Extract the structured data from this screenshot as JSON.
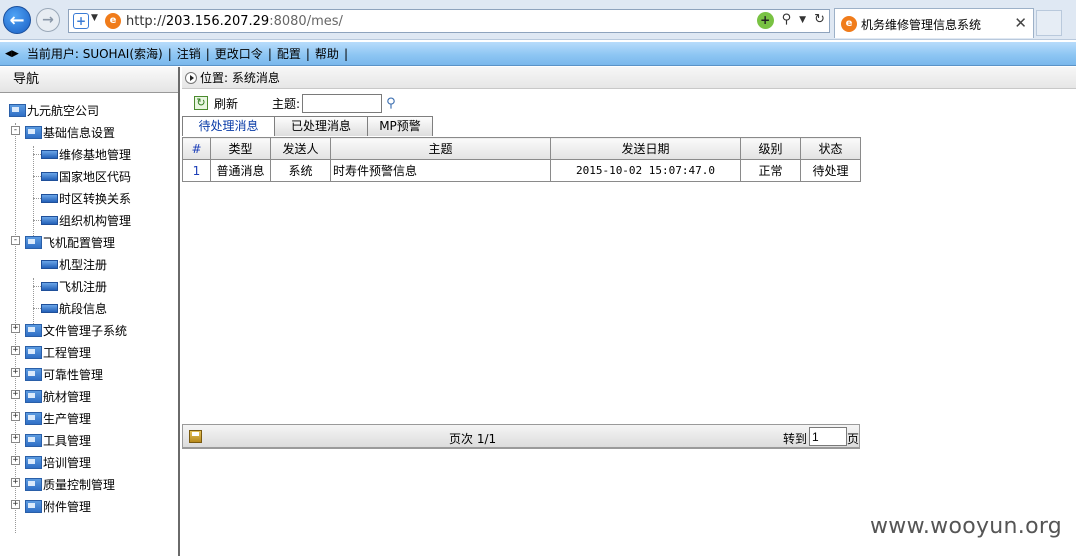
{
  "browser": {
    "url_prefix": "http://",
    "url_host": "203.156.207.29",
    "url_port": ":8080",
    "url_path": "/mes/",
    "tab_title": "机务维修管理信息系统"
  },
  "topbar": {
    "current_user": "当前用户: SUOHAI(索海)",
    "links": [
      "注销",
      "更改口令",
      "配置",
      "帮助"
    ]
  },
  "nav": {
    "header": "导航",
    "root": "九元航空公司",
    "groups": [
      {
        "label": "基础信息设置",
        "expanded": true,
        "children": [
          "维修基地管理",
          "国家地区代码",
          "时区转换关系",
          "组织机构管理"
        ]
      },
      {
        "label": "飞机配置管理",
        "expanded": true,
        "children": [
          "机型注册",
          "飞机注册",
          "航段信息"
        ]
      },
      {
        "label": "文件管理子系统",
        "expanded": false
      },
      {
        "label": "工程管理",
        "expanded": false
      },
      {
        "label": "可靠性管理",
        "expanded": false
      },
      {
        "label": "航材管理",
        "expanded": false
      },
      {
        "label": "生产管理",
        "expanded": false
      },
      {
        "label": "工具管理",
        "expanded": false
      },
      {
        "label": "培训管理",
        "expanded": false
      },
      {
        "label": "质量控制管理",
        "expanded": false
      },
      {
        "label": "附件管理",
        "expanded": false
      }
    ]
  },
  "main": {
    "location": "位置: 系统消息",
    "refresh_label": "刷新",
    "subject_label": "主题:",
    "subject_value": "",
    "tabs": [
      "待处理消息",
      "已处理消息",
      "MP预警"
    ],
    "columns": [
      "#",
      "类型",
      "发送人",
      "主题",
      "发送日期",
      "级别",
      "状态"
    ],
    "rows": [
      [
        "1",
        "普通消息",
        "系统",
        "时寿件预警信息",
        "2015-10-02 15:07:47.0",
        "正常",
        "待处理"
      ]
    ],
    "page_info": "页次 1/1",
    "goto_label": "转到",
    "goto_value": "1",
    "page_unit": "页"
  },
  "watermark": "www.wooyun.org"
}
